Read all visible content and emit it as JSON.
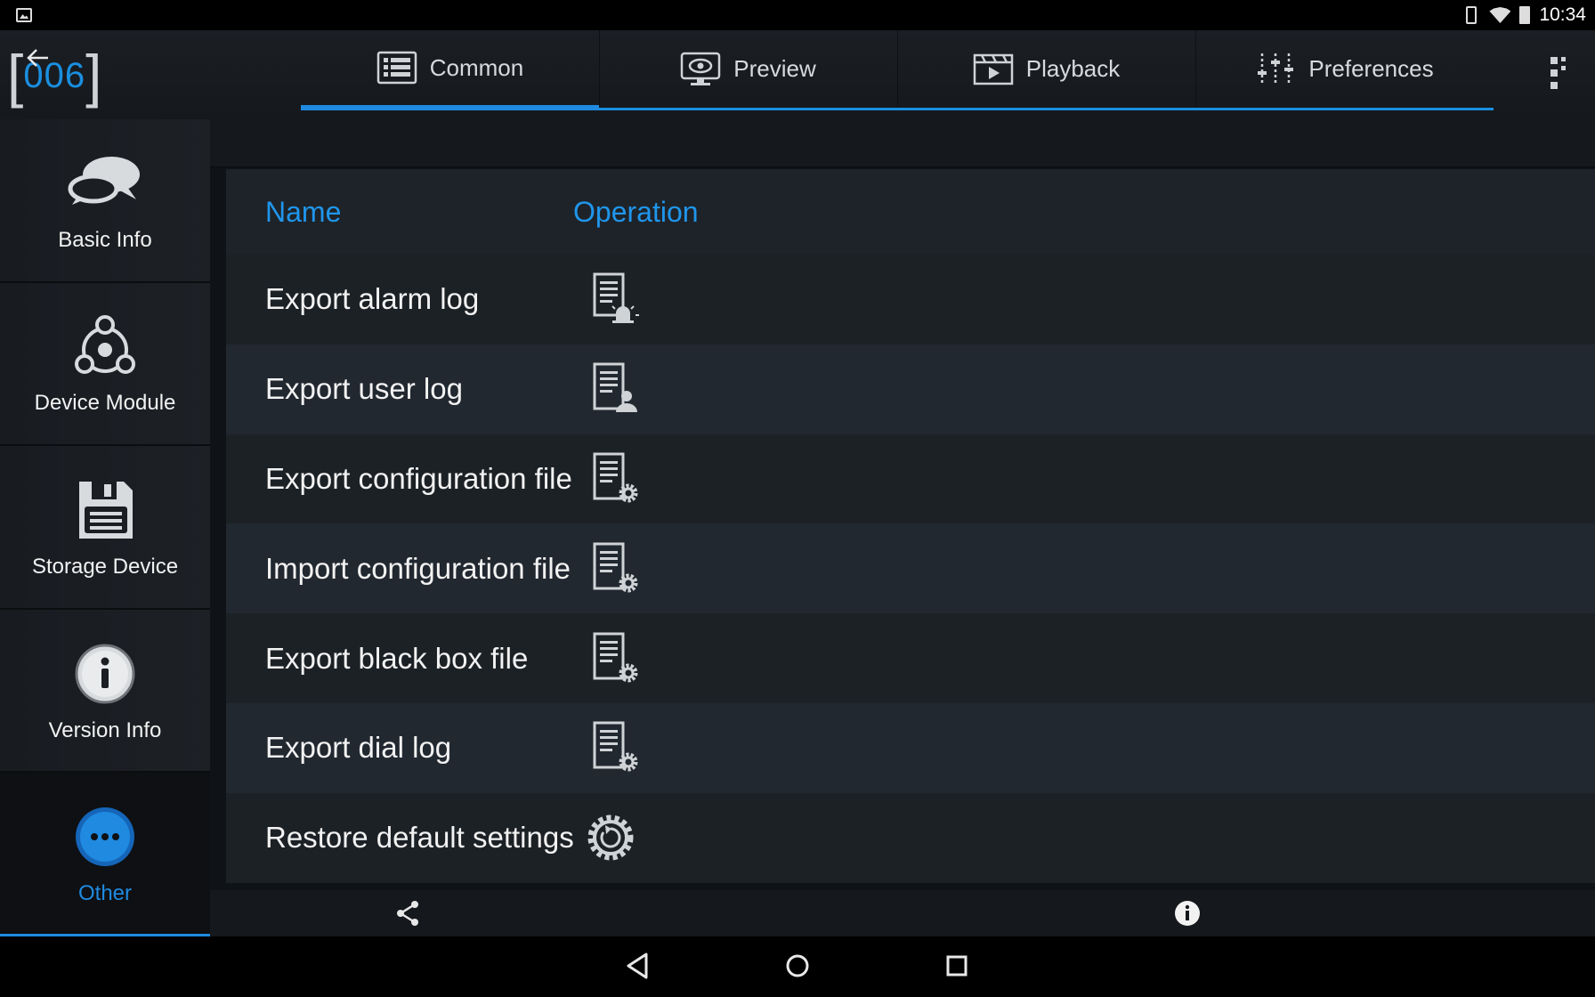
{
  "status_bar": {
    "time": "10:34"
  },
  "header": {
    "logo_left_bracket": "[",
    "logo_number": "006",
    "logo_right_bracket": "]"
  },
  "tabs": [
    {
      "label": "Common",
      "icon": "grid-list-icon",
      "active": true
    },
    {
      "label": "Preview",
      "icon": "monitor-eye-icon",
      "active": false
    },
    {
      "label": "Playback",
      "icon": "film-play-icon",
      "active": false
    },
    {
      "label": "Preferences",
      "icon": "sliders-icon",
      "active": false
    }
  ],
  "sidebar": {
    "items": [
      {
        "label": "Basic Info",
        "icon": "chat-bubbles-icon",
        "active": false
      },
      {
        "label": "Device Module",
        "icon": "modules-icon",
        "active": false
      },
      {
        "label": "Storage Device",
        "icon": "floppy-disk-icon",
        "active": false
      },
      {
        "label": "Version Info",
        "icon": "info-circle-icon",
        "active": false
      },
      {
        "label": "Other",
        "icon": "more-dots-icon",
        "active": true
      }
    ]
  },
  "table": {
    "headers": {
      "name": "Name",
      "operation": "Operation"
    },
    "rows": [
      {
        "name": "Export alarm log",
        "icon": "log-alarm-icon"
      },
      {
        "name": "Export user log",
        "icon": "log-user-icon"
      },
      {
        "name": "Export configuration file",
        "icon": "log-gear-icon"
      },
      {
        "name": "Import configuration file",
        "icon": "log-gear-icon"
      },
      {
        "name": "Export black box file",
        "icon": "log-gear-icon"
      },
      {
        "name": "Export dial log",
        "icon": "log-gear-icon"
      },
      {
        "name": "Restore default settings",
        "icon": "restore-gear-icon"
      }
    ]
  },
  "colors": {
    "accent": "#1f8ae0",
    "header_text": "#1f96ec",
    "background": "#0f1216"
  }
}
